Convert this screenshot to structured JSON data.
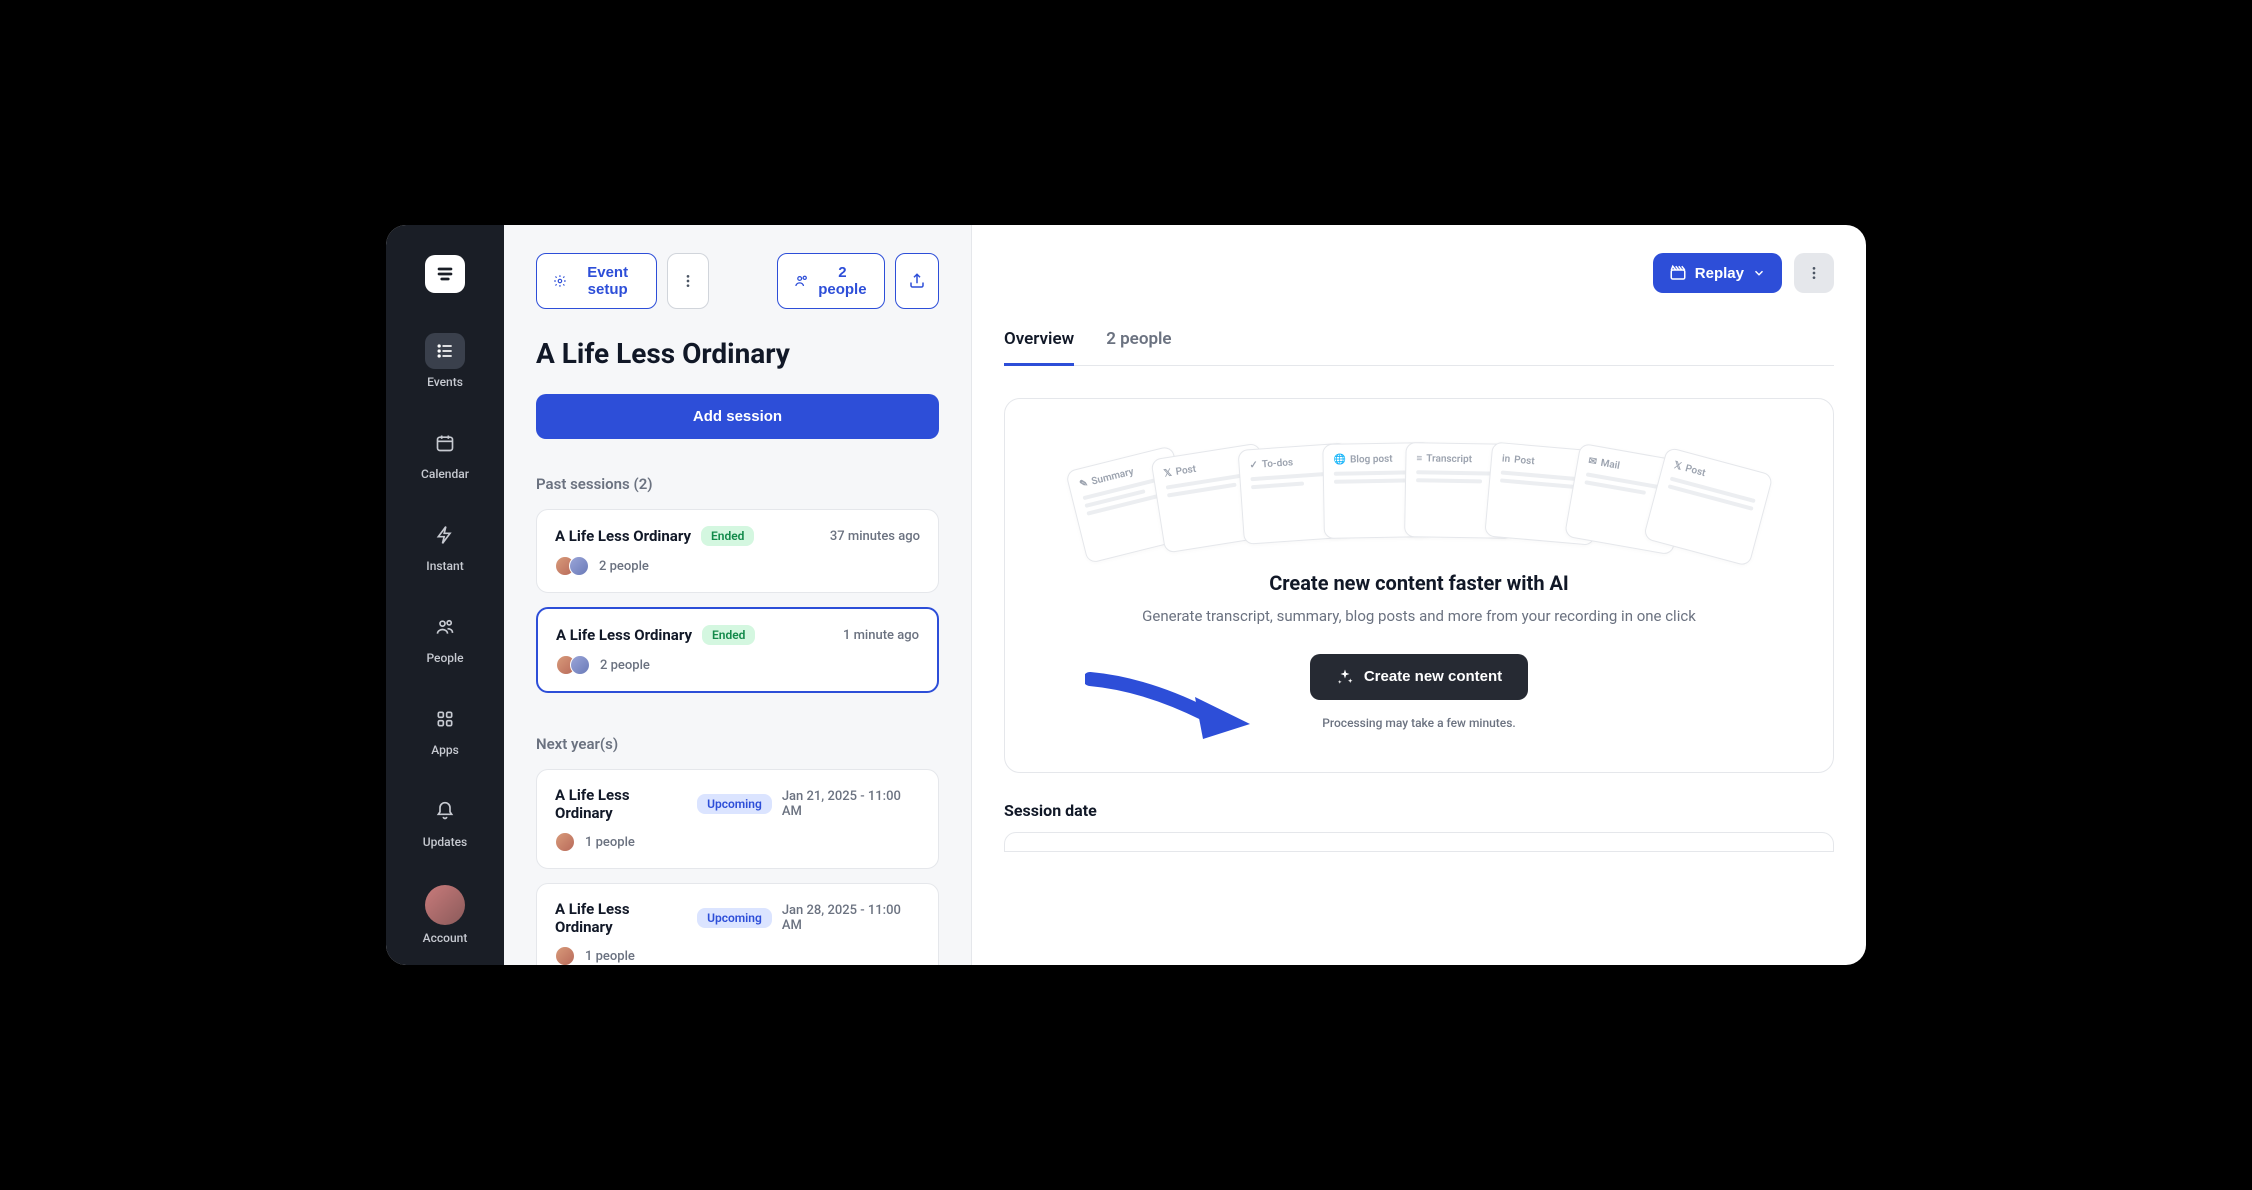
{
  "nav": {
    "items": [
      {
        "label": "Events"
      },
      {
        "label": "Calendar"
      },
      {
        "label": "Instant"
      },
      {
        "label": "People"
      },
      {
        "label": "Apps"
      },
      {
        "label": "Updates"
      },
      {
        "label": "Account"
      }
    ]
  },
  "toolbar": {
    "event_setup": "Event setup",
    "people": "2 people"
  },
  "page_title": "A Life Less Ordinary",
  "add_session": "Add session",
  "sections": {
    "past": "Past sessions (2)",
    "next": "Next year(s)"
  },
  "sessions": {
    "past": [
      {
        "title": "A Life Less Ordinary",
        "status": "Ended",
        "time": "37 minutes ago",
        "people": "2 people",
        "avatars": 2
      },
      {
        "title": "A Life Less Ordinary",
        "status": "Ended",
        "time": "1 minute ago",
        "people": "2 people",
        "avatars": 2
      }
    ],
    "next": [
      {
        "title": "A Life Less Ordinary",
        "status": "Upcoming",
        "time": "Jan 21, 2025 - 11:00 AM",
        "people": "1 people",
        "avatars": 1
      },
      {
        "title": "A Life Less Ordinary",
        "status": "Upcoming",
        "time": "Jan 28, 2025 - 11:00 AM",
        "people": "1 people",
        "avatars": 1
      }
    ]
  },
  "main": {
    "replay": "Replay",
    "tabs": [
      {
        "label": "Overview"
      },
      {
        "label": "2 people"
      }
    ],
    "illus_cards": [
      "Summary",
      "Post",
      "To-dos",
      "Blog post",
      "Transcript",
      "Post",
      "Mail",
      "Post"
    ],
    "ai_heading": "Create new content faster with AI",
    "ai_sub": "Generate transcript, summary, blog posts and more from your recording in one click",
    "create_btn": "Create new content",
    "note": "Processing may take a few minutes.",
    "field_session_date": "Session date"
  }
}
